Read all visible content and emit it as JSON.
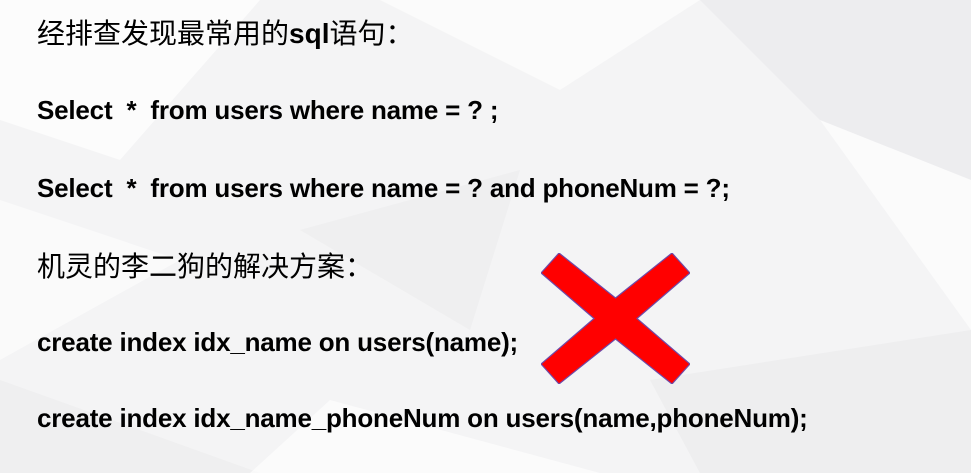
{
  "heading": {
    "prefix": "经排查发现最常用的",
    "sql_word": "sql",
    "suffix": "语句："
  },
  "queries": {
    "query1": "Select  *  from users where name = ? ;",
    "query2": "Select  *  from users where name = ? and phoneNum = ?;"
  },
  "solution_heading": "机灵的李二狗的解决方案：",
  "indexes": {
    "index1": "create index idx_name on users(name);",
    "index2": "create index idx_name_phoneNum on users(name,phoneNum);"
  },
  "colors": {
    "cross_fill": "#ff0000",
    "cross_stroke": "#6e4aa8",
    "background": "#f4f4f5"
  },
  "icons": {
    "cross": "red-x-mark-icon"
  }
}
